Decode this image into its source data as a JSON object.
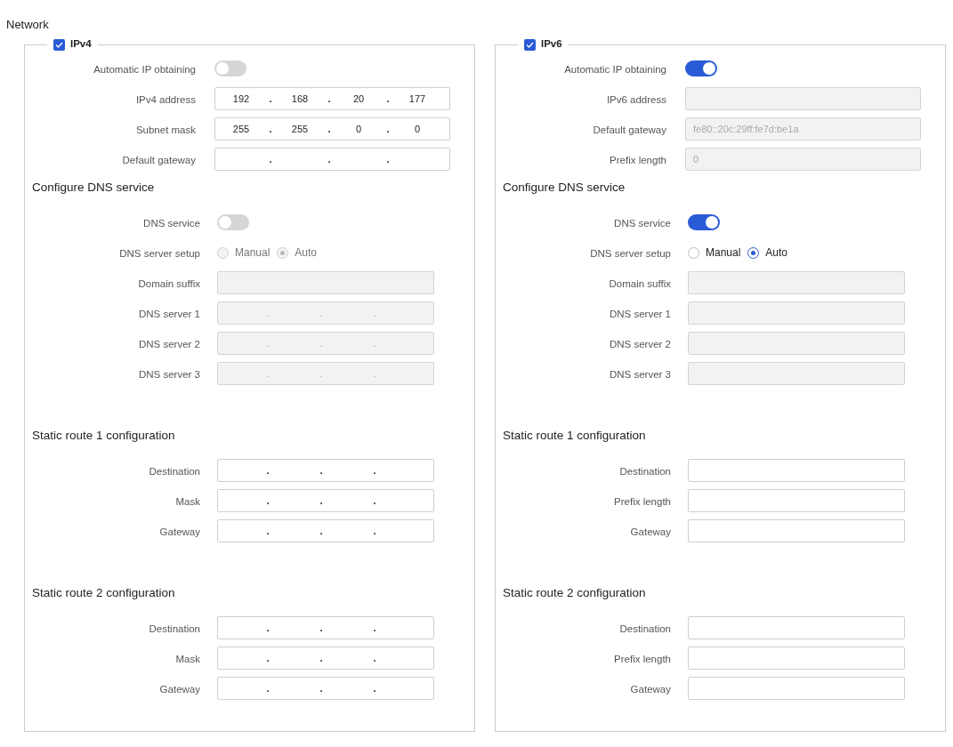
{
  "title": "Network",
  "panels": [
    {
      "checkbox": {
        "label": "IPv4",
        "checked": true
      },
      "rows": [
        {
          "kind": "toggle",
          "label": "Automatic IP obtaining",
          "on": false
        },
        {
          "kind": "ip",
          "label": "IPv4 address",
          "octets": [
            "192",
            "168",
            "20",
            "177"
          ],
          "dots": [
            ".",
            ".",
            "."
          ],
          "disabled": false
        },
        {
          "kind": "ip",
          "label": "Subnet mask",
          "octets": [
            "255",
            "255",
            "0",
            "0"
          ],
          "dots": [
            ".",
            ".",
            "."
          ],
          "disabled": false
        },
        {
          "kind": "ip",
          "label": "Default gateway",
          "dots": [
            ".",
            ".",
            "."
          ],
          "disabled": false
        }
      ],
      "sections": [
        {
          "heading": "Configure DNS service",
          "rows": [
            {
              "kind": "toggle",
              "label": "DNS service",
              "on": false
            },
            {
              "kind": "radio",
              "label": "DNS server setup",
              "options": [
                {
                  "label": "Manual",
                  "selected": false,
                  "disabled": true
                },
                {
                  "label": "Auto",
                  "selected": true,
                  "disabled": true
                }
              ]
            },
            {
              "kind": "text",
              "label": "Domain suffix",
              "disabled": true
            },
            {
              "kind": "ip",
              "label": "DNS server 1",
              "dots": [
                ".",
                ".",
                "."
              ],
              "disabled": true
            },
            {
              "kind": "ip",
              "label": "DNS server 2",
              "dots": [
                ".",
                ".",
                "."
              ],
              "disabled": true
            },
            {
              "kind": "ip",
              "label": "DNS server 3",
              "dots": [
                ".",
                ".",
                "."
              ],
              "disabled": true
            }
          ]
        },
        {
          "heading": "Static route 1 configuration",
          "rows": [
            {
              "kind": "ip",
              "label": "Destination",
              "dots": [
                ".",
                ".",
                "."
              ],
              "disabled": false
            },
            {
              "kind": "ip",
              "label": "Mask",
              "dots": [
                ".",
                ".",
                "."
              ],
              "disabled": false
            },
            {
              "kind": "ip",
              "label": "Gateway",
              "dots": [
                ".",
                ".",
                "."
              ],
              "disabled": false
            }
          ]
        },
        {
          "heading": "Static route 2 configuration",
          "rows": [
            {
              "kind": "ip",
              "label": "Destination",
              "dots": [
                ".",
                ".",
                "."
              ],
              "disabled": false
            },
            {
              "kind": "ip",
              "label": "Mask",
              "dots": [
                ".",
                ".",
                "."
              ],
              "disabled": false
            },
            {
              "kind": "ip",
              "label": "Gateway",
              "dots": [
                ".",
                ".",
                "."
              ],
              "disabled": false
            }
          ]
        }
      ]
    },
    {
      "checkbox": {
        "label": "IPv6",
        "checked": true
      },
      "rows": [
        {
          "kind": "toggle",
          "label": "Automatic IP obtaining",
          "on": true
        },
        {
          "kind": "text",
          "label": "IPv6 address",
          "disabled": true
        },
        {
          "kind": "text",
          "label": "Default gateway",
          "value": "fe80::20c:29ff:fe7d:be1a",
          "disabled": true
        },
        {
          "kind": "text",
          "label": "Prefix length",
          "value": "0",
          "disabled": true
        }
      ],
      "sections": [
        {
          "heading": "Configure DNS service",
          "rows": [
            {
              "kind": "toggle",
              "label": "DNS service",
              "on": true
            },
            {
              "kind": "radio",
              "label": "DNS server setup",
              "options": [
                {
                  "label": "Manual",
                  "selected": false,
                  "disabled": false
                },
                {
                  "label": "Auto",
                  "selected": true,
                  "disabled": false
                }
              ]
            },
            {
              "kind": "text",
              "label": "Domain suffix",
              "disabled": true
            },
            {
              "kind": "text",
              "label": "DNS server 1",
              "disabled": true
            },
            {
              "kind": "text",
              "label": "DNS server 2",
              "disabled": true
            },
            {
              "kind": "text",
              "label": "DNS server 3",
              "disabled": true
            }
          ]
        },
        {
          "heading": "Static route 1 configuration",
          "rows": [
            {
              "kind": "text",
              "label": "Destination",
              "disabled": false
            },
            {
              "kind": "text",
              "label": "Prefix length",
              "disabled": false
            },
            {
              "kind": "text",
              "label": "Gateway",
              "disabled": false
            }
          ]
        },
        {
          "heading": "Static route 2 configuration",
          "rows": [
            {
              "kind": "text",
              "label": "Destination",
              "disabled": false
            },
            {
              "kind": "text",
              "label": "Prefix length",
              "disabled": false
            },
            {
              "kind": "text",
              "label": "Gateway",
              "disabled": false
            }
          ]
        }
      ]
    }
  ]
}
